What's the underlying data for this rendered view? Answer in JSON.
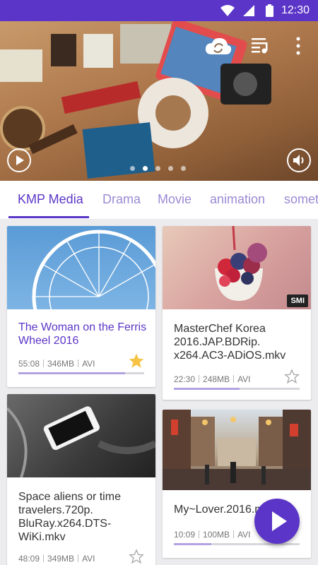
{
  "status_bar": {
    "time": "12:30"
  },
  "hero": {
    "slides_count": 5,
    "active_slide": 1
  },
  "tabs": [
    {
      "label": "KMP Media",
      "active": true
    },
    {
      "label": "Drama",
      "active": false
    },
    {
      "label": "Movie",
      "active": false
    },
    {
      "label": "animation",
      "active": false
    },
    {
      "label": "somet",
      "active": false
    }
  ],
  "cards": [
    {
      "title": "The Woman on the Ferris Wheel 2016",
      "duration": "55:08",
      "size": "346MB",
      "format": "AVI",
      "progress": 0.85,
      "favorite": true,
      "highlight": true,
      "badge": ""
    },
    {
      "title": "MasterChef Korea 2016.JAP.BDRip. x264.AC3-ADiOS.mkv",
      "duration": "22:30",
      "size": "248MB",
      "format": "AVI",
      "progress": 0.52,
      "favorite": false,
      "highlight": false,
      "badge": "SMI"
    },
    {
      "title": "Space aliens or time travelers.720p. BluRay.x264.DTS-WiKi.mkv",
      "duration": "48:09",
      "size": "349MB",
      "format": "AVI",
      "progress": 0.0,
      "favorite": false,
      "highlight": false,
      "badge": ""
    },
    {
      "title": "My~Lover.2016.mp4",
      "duration": "10:09",
      "size": "100MB",
      "format": "AVI",
      "progress": 0.3,
      "favorite": false,
      "highlight": false,
      "badge": ""
    }
  ],
  "colors": {
    "accent": "#5b35c7",
    "star_active": "#f6c342"
  },
  "icons": [
    "wifi-icon",
    "signal-icon",
    "battery-icon",
    "cloud-sync-icon",
    "playlist-icon",
    "more-icon",
    "play-icon",
    "volume-icon",
    "star-icon"
  ]
}
